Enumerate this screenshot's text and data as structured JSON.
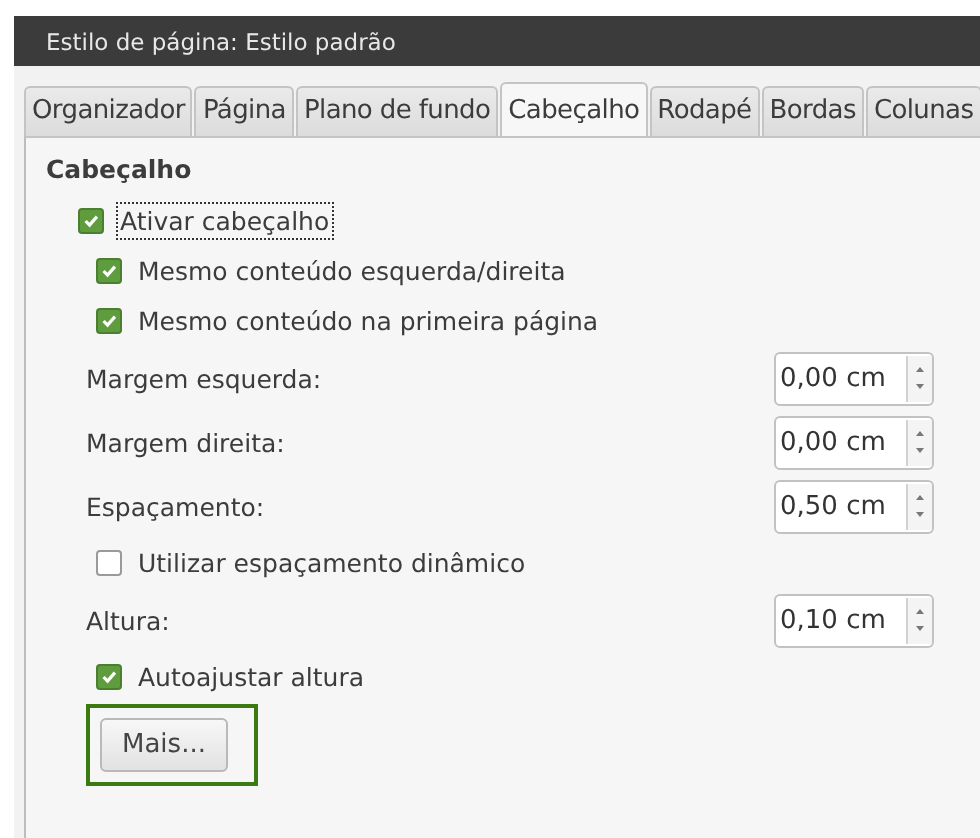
{
  "window": {
    "title": "Estilo de página: Estilo padrão"
  },
  "tabs": [
    {
      "label": "Organizador",
      "selected": false
    },
    {
      "label": "Página",
      "selected": false
    },
    {
      "label": "Plano de fundo",
      "selected": false
    },
    {
      "label": "Cabeçalho",
      "selected": true
    },
    {
      "label": "Rodapé",
      "selected": false
    },
    {
      "label": "Bordas",
      "selected": false
    },
    {
      "label": "Colunas",
      "selected": false
    }
  ],
  "section": {
    "title": "Cabeçalho"
  },
  "items": [
    {
      "kind": "master",
      "label": "Ativar cabeçalho",
      "checked": true,
      "focused": true
    },
    {
      "kind": "checkbox",
      "label": "Mesmo conteúdo esquerda/direita",
      "checked": true
    },
    {
      "kind": "checkbox",
      "label": "Mesmo conteúdo na primeira página",
      "checked": true
    },
    {
      "kind": "spin",
      "label": "Margem esquerda:",
      "value": "0,00 cm"
    },
    {
      "kind": "spin",
      "label": "Margem direita:",
      "value": "0,00 cm"
    },
    {
      "kind": "spin",
      "label": "Espaçamento:",
      "value": "0,50 cm"
    },
    {
      "kind": "checkbox",
      "label": "Utilizar espaçamento dinâmico",
      "checked": false
    },
    {
      "kind": "spin",
      "label": "Altura:",
      "value": "0,10 cm"
    },
    {
      "kind": "checkbox",
      "label": "Autoajustar altura",
      "checked": true
    },
    {
      "kind": "button",
      "label": "Mais...",
      "highlighted": true
    }
  ]
}
